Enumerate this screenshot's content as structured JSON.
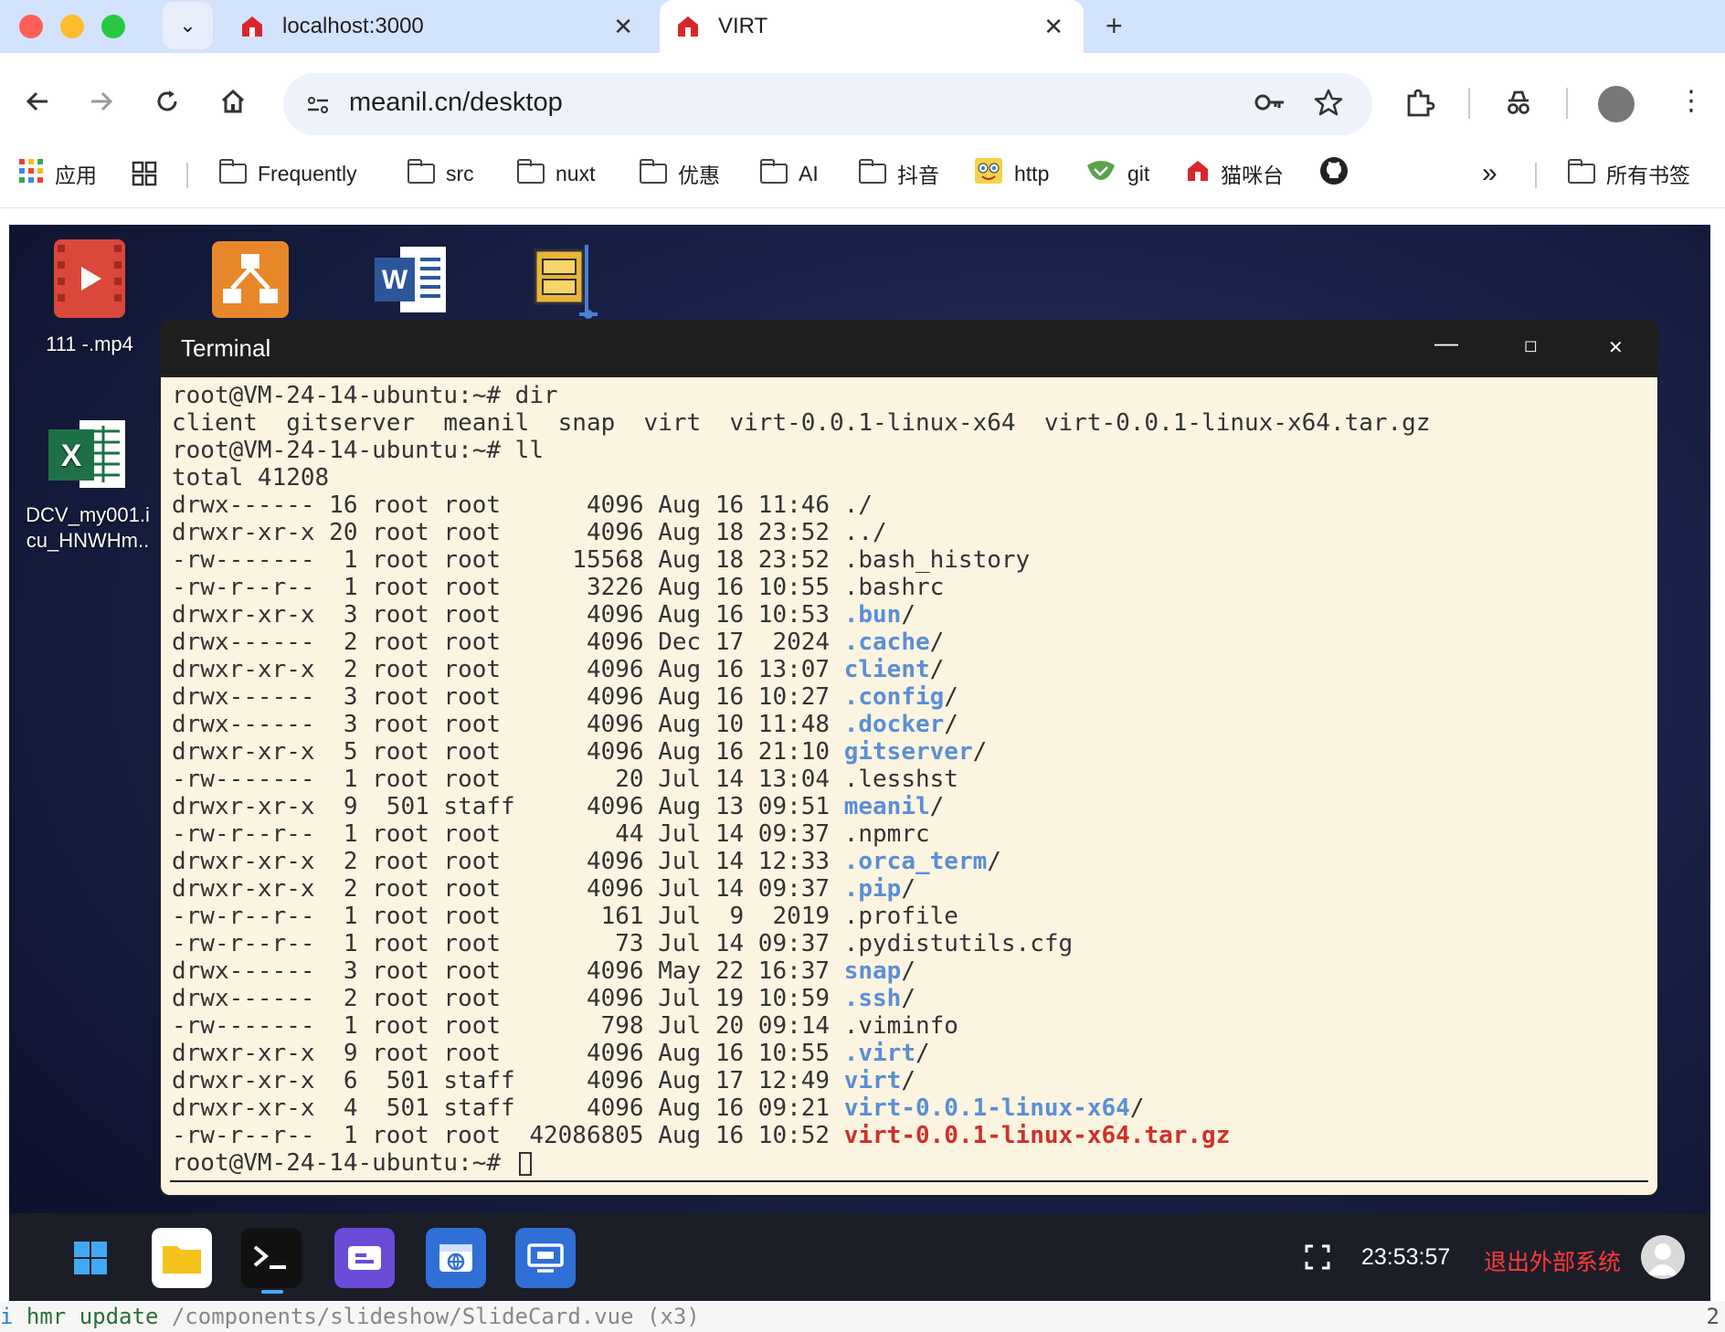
{
  "browser": {
    "tabs": [
      {
        "label": "localhost:3000"
      },
      {
        "label": "VIRT"
      }
    ],
    "url": "meanil.cn/desktop",
    "bookmarks": {
      "apps": "应用",
      "items": [
        "Frequently",
        "src",
        "nuxt",
        "优惠",
        "AI",
        "抖音",
        "http",
        "git",
        "猫咪台"
      ],
      "more": "»",
      "all": "所有书签"
    }
  },
  "desktop": {
    "icons": [
      {
        "label": "111 -.mp4",
        "icon": "video-file-icon"
      },
      {
        "label": "",
        "icon": "flowchart-app-icon"
      },
      {
        "label": "",
        "icon": "word-doc-icon"
      },
      {
        "label": "",
        "icon": "archive-app-icon"
      },
      {
        "label": "DCV_my001.i\ncu_HNWHm..",
        "icon": "excel-file-icon"
      }
    ]
  },
  "terminal": {
    "title": "Terminal",
    "lines": [
      [
        {
          "t": "root@VM-24-14-ubuntu:~# dir"
        }
      ],
      [
        {
          "t": "client  gitserver  meanil  snap  virt  virt-0.0.1-linux-x64  virt-0.0.1-linux-x64.tar.gz"
        }
      ],
      [
        {
          "t": "root@VM-24-14-ubuntu:~# ll"
        }
      ],
      [
        {
          "t": "total 41208"
        }
      ],
      [
        {
          "t": "drwx------ 16 root root      4096 Aug 16 11:46 ./"
        }
      ],
      [
        {
          "t": "drwxr-xr-x 20 root root      4096 Aug 18 23:52 ../"
        }
      ],
      [
        {
          "t": "-rw-------  1 root root     15568 Aug 18 23:52 .bash_history"
        }
      ],
      [
        {
          "t": "-rw-r--r--  1 root root      3226 Aug 16 10:55 .bashrc"
        }
      ],
      [
        {
          "t": "drwxr-xr-x  3 root root      4096 Aug 16 10:53 "
        },
        {
          "t": ".bun",
          "c": "blue"
        },
        {
          "t": "/"
        }
      ],
      [
        {
          "t": "drwx------  2 root root      4096 Dec 17  2024 "
        },
        {
          "t": ".cache",
          "c": "blue"
        },
        {
          "t": "/"
        }
      ],
      [
        {
          "t": "drwxr-xr-x  2 root root      4096 Aug 16 13:07 "
        },
        {
          "t": "client",
          "c": "blue"
        },
        {
          "t": "/"
        }
      ],
      [
        {
          "t": "drwx------  3 root root      4096 Aug 16 10:27 "
        },
        {
          "t": ".config",
          "c": "blue"
        },
        {
          "t": "/"
        }
      ],
      [
        {
          "t": "drwx------  3 root root      4096 Aug 10 11:48 "
        },
        {
          "t": ".docker",
          "c": "blue"
        },
        {
          "t": "/"
        }
      ],
      [
        {
          "t": "drwxr-xr-x  5 root root      4096 Aug 16 21:10 "
        },
        {
          "t": "gitserver",
          "c": "blue"
        },
        {
          "t": "/"
        }
      ],
      [
        {
          "t": "-rw-------  1 root root        20 Jul 14 13:04 .lesshst"
        }
      ],
      [
        {
          "t": "drwxr-xr-x  9  501 staff     4096 Aug 13 09:51 "
        },
        {
          "t": "meanil",
          "c": "blue"
        },
        {
          "t": "/"
        }
      ],
      [
        {
          "t": "-rw-r--r--  1 root root        44 Jul 14 09:37 .npmrc"
        }
      ],
      [
        {
          "t": "drwxr-xr-x  2 root root      4096 Jul 14 12:33 "
        },
        {
          "t": ".orca_term",
          "c": "blue"
        },
        {
          "t": "/"
        }
      ],
      [
        {
          "t": "drwxr-xr-x  2 root root      4096 Jul 14 09:37 "
        },
        {
          "t": ".pip",
          "c": "blue"
        },
        {
          "t": "/"
        }
      ],
      [
        {
          "t": "-rw-r--r--  1 root root       161 Jul  9  2019 .profile"
        }
      ],
      [
        {
          "t": "-rw-r--r--  1 root root        73 Jul 14 09:37 .pydistutils.cfg"
        }
      ],
      [
        {
          "t": "drwx------  3 root root      4096 May 22 16:37 "
        },
        {
          "t": "snap",
          "c": "blue"
        },
        {
          "t": "/"
        }
      ],
      [
        {
          "t": "drwx------  2 root root      4096 Jul 19 10:59 "
        },
        {
          "t": ".ssh",
          "c": "blue"
        },
        {
          "t": "/"
        }
      ],
      [
        {
          "t": "-rw-------  1 root root       798 Jul 20 09:14 .viminfo"
        }
      ],
      [
        {
          "t": "drwxr-xr-x  9 root root      4096 Aug 16 10:55 "
        },
        {
          "t": ".virt",
          "c": "blue"
        },
        {
          "t": "/"
        }
      ],
      [
        {
          "t": "drwxr-xr-x  6  501 staff     4096 Aug 17 12:49 "
        },
        {
          "t": "virt",
          "c": "blue"
        },
        {
          "t": "/"
        }
      ],
      [
        {
          "t": "drwxr-xr-x  4  501 staff     4096 Aug 16 09:21 "
        },
        {
          "t": "virt-0.0.1-linux-x64",
          "c": "blue"
        },
        {
          "t": "/"
        }
      ],
      [
        {
          "t": "-rw-r--r--  1 root root  42086805 Aug 16 10:52 "
        },
        {
          "t": "virt-0.0.1-linux-x64.tar.gz",
          "c": "red"
        }
      ],
      [
        {
          "t": "root@VM-24-14-ubuntu:~# "
        }
      ]
    ]
  },
  "taskbar": {
    "time": "23:53:57",
    "exit_label": "退出外部系统"
  },
  "console": {
    "prefix": "i",
    "message": " hmr update ",
    "path": "/components/slideshow/SlideCard.vue (x3)",
    "right": "2"
  }
}
